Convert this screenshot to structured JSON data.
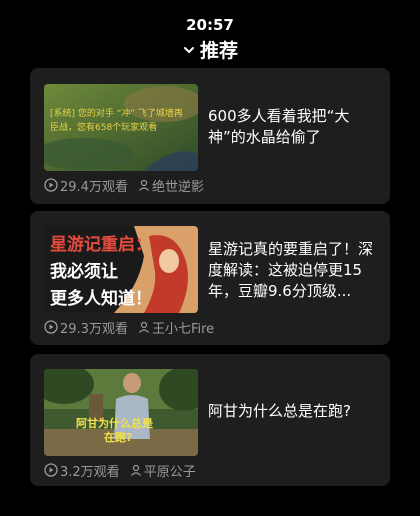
{
  "status": {
    "time": "20:57"
  },
  "header": {
    "title": "推荐"
  },
  "feed": [
    {
      "title": "600多人看着我把“大神”的水晶给偷了",
      "views": "29.4万观看",
      "author": "绝世逆影",
      "thumb_text": {
        "line1": "[系统] 您的对手 “冲” 飞了城墙再",
        "line2": "臣战，您有658个玩家观看"
      }
    },
    {
      "title": "星游记真的要重启了！深度解读：这被迫停更15年，豆瓣9.6分顶级...",
      "views": "29.3万观看",
      "author": "王小七Fire",
      "thumb_text": {
        "line1": "星游记重启：",
        "line2": "我必须让",
        "line3": "更多人知道！"
      }
    },
    {
      "title": "阿甘为什么总是在跑?",
      "views": "3.2万观看",
      "author": "平原公子",
      "thumb_text": {
        "line1": "阿甘为什么总是",
        "line2": "在跑?"
      }
    }
  ]
}
